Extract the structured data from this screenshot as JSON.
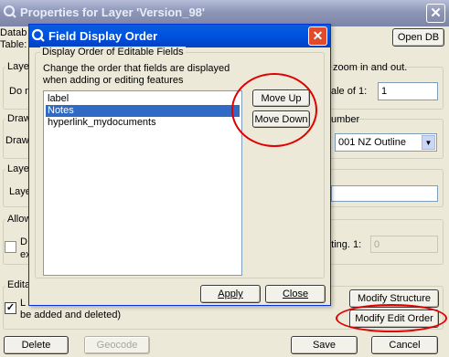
{
  "main_window": {
    "title": "Properties for Layer 'Version_98'",
    "left_labels": {
      "database": "Datab",
      "table": "Table:",
      "layer1": "Laye",
      "do_n": "Do n",
      "draw1": "Draw",
      "draw2": "Draw",
      "layer2": "Laye",
      "layer3": "Laye",
      "allow": "Allow",
      "d": "D",
      "ex": "ex",
      "edit": "Edita",
      "l": "L",
      "added_deleted": "be added and deleted)"
    },
    "right_labels": {
      "zoom": "zoom in and out.",
      "scale_of": "ale of  1:",
      "number": "umber",
      "setting": "etting.  1:"
    },
    "open_db_label": "Open DB",
    "scale_value": "1",
    "style_select_value": "001 NZ Outline",
    "setting_value": "0",
    "modify_structure_label": "Modify Structure",
    "modify_edit_order_label": "Modify Edit Order",
    "delete_label": "Delete",
    "geocode_label": "Geocode",
    "save_label": "Save",
    "cancel_label": "Cancel"
  },
  "dialog": {
    "title": "Field Display Order",
    "group_label": "Display Order of Editable Fields",
    "description_line1": "Change the order that fields are displayed",
    "description_line2": "when adding or editing features",
    "fields": [
      "label",
      "Notes",
      "hyperlink_mydocuments"
    ],
    "selected_field": "Notes",
    "move_up_label": "Move Up",
    "move_down_label": "Move Down",
    "apply_label": "Apply",
    "close_label": "Close"
  },
  "colors": {
    "annotation_red": "#e00000",
    "selection_blue": "#316ac5",
    "dialog_title_blue": "#0054e3"
  },
  "icons": {
    "app_icon": "q-globe-icon",
    "close_icon": "close-icon",
    "dropdown_icon": "chevron-down-icon"
  }
}
